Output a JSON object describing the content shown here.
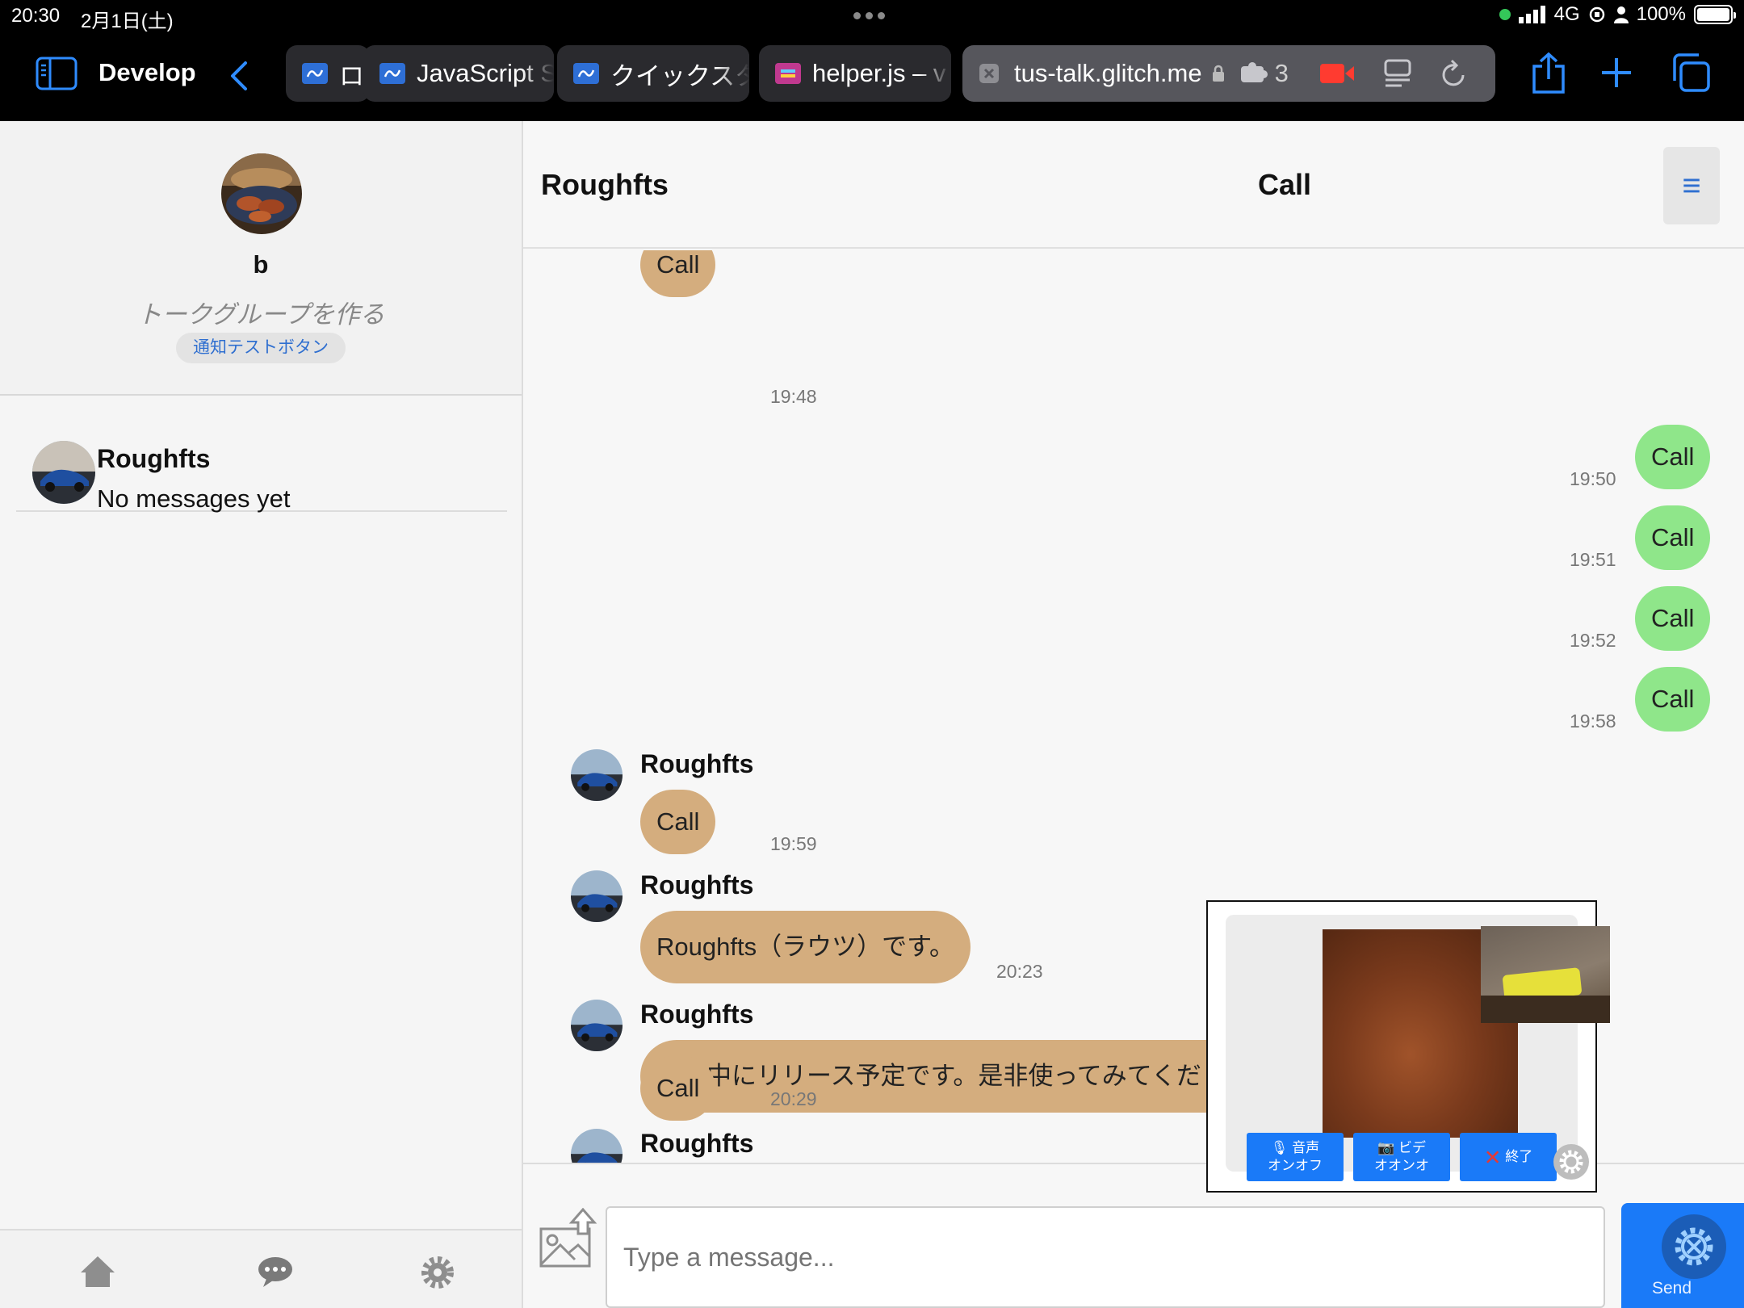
{
  "status": {
    "time": "20:30",
    "date": "2月1日(土)",
    "network": "4G",
    "battery": "100%"
  },
  "toolbar": {
    "develop_label": "Develop",
    "tabs": [
      {
        "label": "ロ"
      },
      {
        "label": "JavaScript S"
      },
      {
        "label": "クイックスタ"
      },
      {
        "label": "helper.js – v"
      },
      {
        "label": "tus-talk.glitch.me"
      }
    ],
    "extension_count": "3"
  },
  "sidebar": {
    "username": "b",
    "create_group": "トークグループを作る",
    "notify_test": "通知テストボタン",
    "chats": [
      {
        "name": "Roughfts",
        "preview": "No messages yet"
      }
    ]
  },
  "header": {
    "title": "Roughfts",
    "center": "Call",
    "menu_icon": "≡"
  },
  "messages": [
    {
      "text": "Call",
      "time": "19:48",
      "direction": "in"
    },
    {
      "text": "Call",
      "time": "19:50",
      "direction": "out"
    },
    {
      "text": "Call",
      "time": "19:51",
      "direction": "out"
    },
    {
      "text": "Call",
      "time": "19:52",
      "direction": "out"
    },
    {
      "text": "Call",
      "time": "19:58",
      "direction": "out"
    },
    {
      "sender": "Roughfts",
      "text": "Call",
      "time": "19:59",
      "direction": "in"
    },
    {
      "sender": "Roughfts",
      "text": "Roughfts（ラウツ）です。",
      "time": "20:23",
      "direction": "in"
    },
    {
      "sender": "Roughfts",
      "text": "今週中にリリース予定です。是非使ってみてくだ",
      "time": "",
      "direction": "in"
    },
    {
      "sender": "Roughfts",
      "text": "Call",
      "time": "20:29",
      "direction": "in"
    }
  ],
  "input": {
    "placeholder": "Type a message...",
    "send_label": "Send"
  },
  "call_window": {
    "audio_line1": "音声",
    "audio_line2": "オンオフ",
    "video_line1": "ビデ",
    "video_line2": "オオンオ",
    "end_label": "終了"
  },
  "colors": {
    "incoming_bubble": "#d4ad7e",
    "outgoing_bubble": "#8fe68a",
    "accent": "#1a7af8"
  }
}
